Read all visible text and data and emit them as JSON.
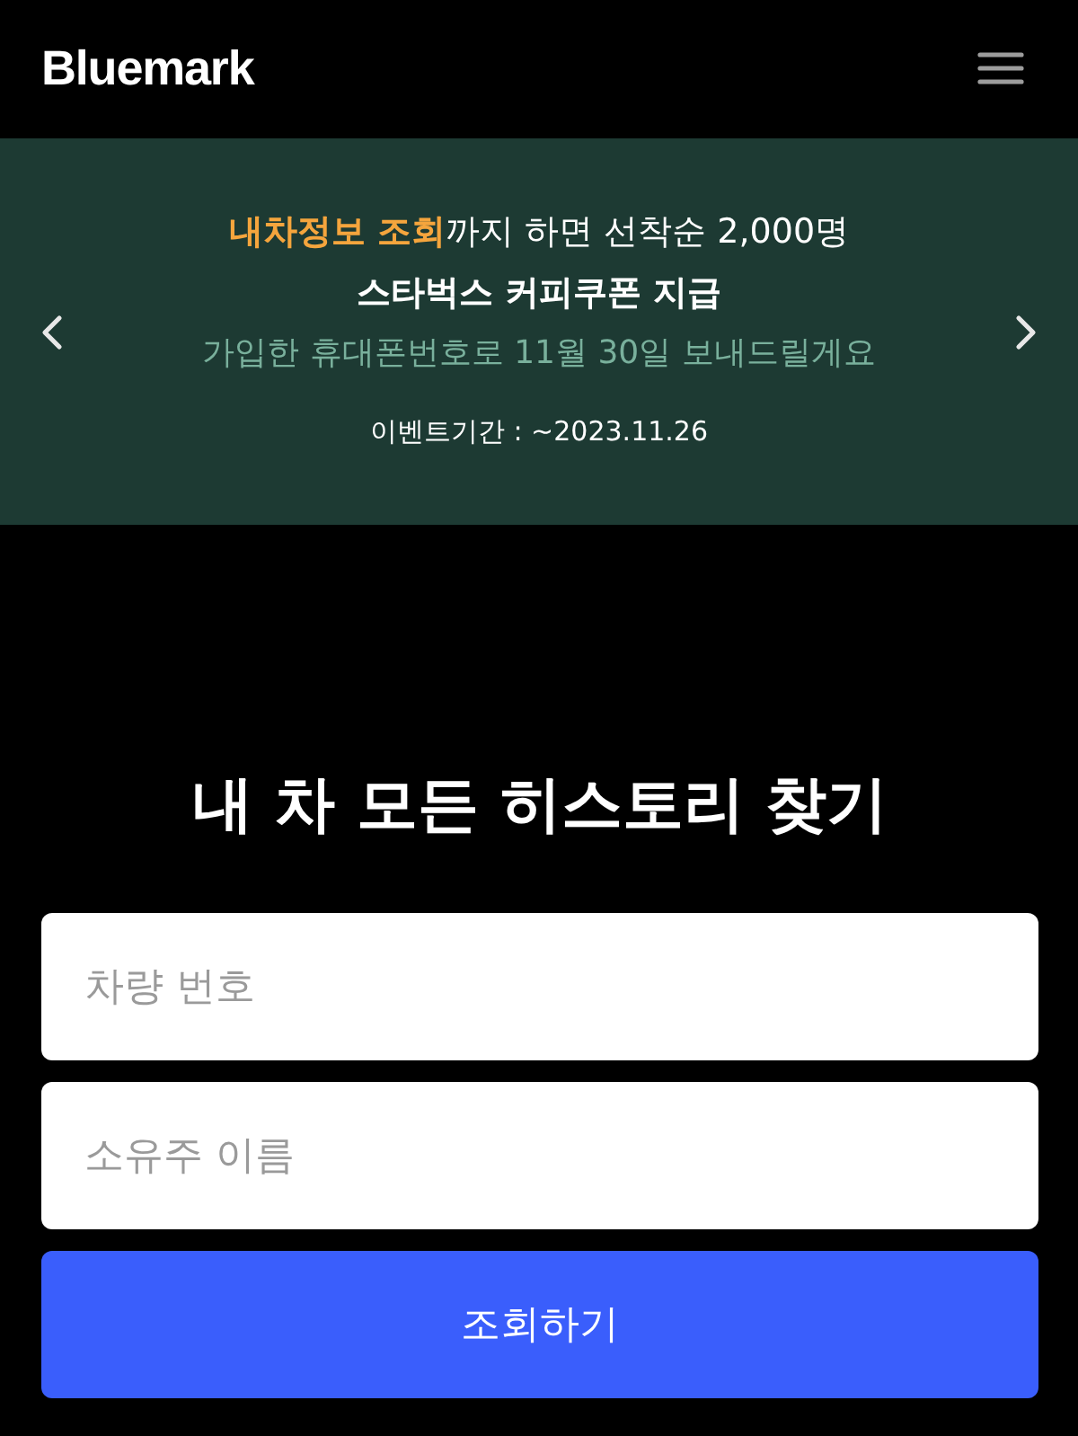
{
  "header": {
    "logo": "Bluemark"
  },
  "banner": {
    "headline": {
      "highlight": "내차정보 조회",
      "rest": "까지 하면 선착순 2,000명"
    },
    "title": "스타벅스 커피쿠폰 지급",
    "note": "가입한 휴대폰번호로 11월 30일 보내드릴게요",
    "period": "이벤트기간 : ~2023.11.26"
  },
  "search": {
    "heading": "내 차 모든 히스토리 찾기",
    "fields": [
      {
        "placeholder": "차량 번호"
      },
      {
        "placeholder": "소유주 이름"
      }
    ],
    "submit": "조회하기"
  }
}
